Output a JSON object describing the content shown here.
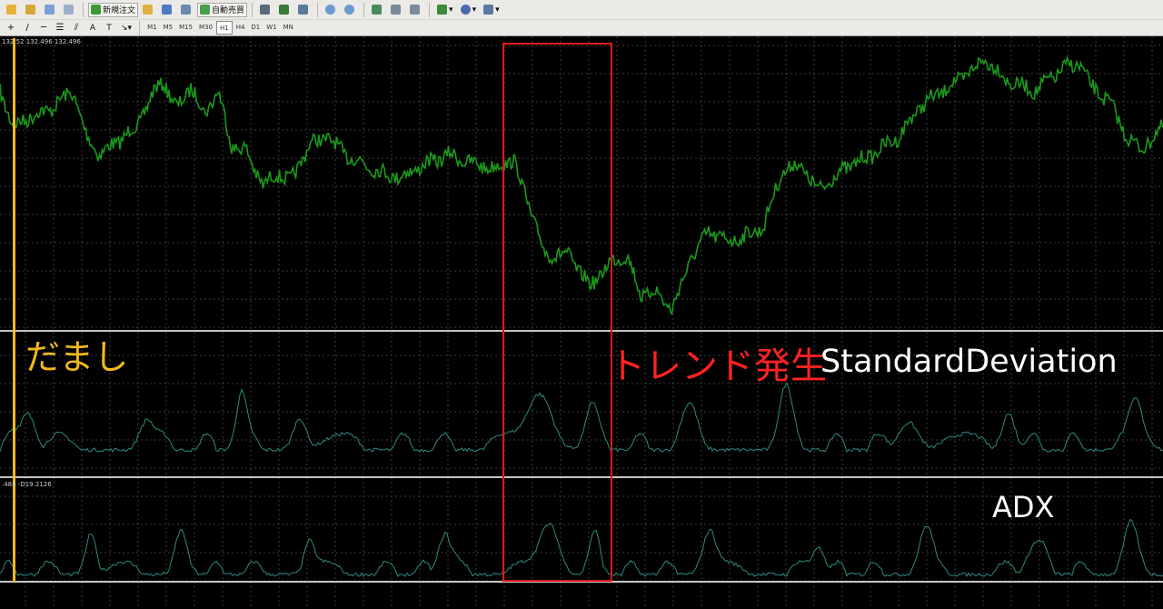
{
  "toolbar": {
    "new_order_label": "新規注文",
    "auto_trade_label": "自動売買"
  },
  "timeframes": [
    "M1",
    "M5",
    "M15",
    "M30",
    "H1",
    "H4",
    "D1",
    "W1",
    "MN"
  ],
  "active_timeframe": "H1",
  "price_readout": "132.52 132.496 132.496",
  "adx_readout": ".484 -D19.2126",
  "annotations": {
    "fake_signal": "だまし",
    "trend_start": "トレンド発生",
    "stddev_name": "StandardDeviation",
    "adx_name": "ADX"
  },
  "colors": {
    "price_line": "#1a9a1a",
    "indicator_line": "#2e8a80",
    "grid": "#3c3c3c",
    "separator": "#c4c4c4",
    "fake_box": "#f2b91c",
    "trend_box": "#e01818",
    "trend_text": "#ff2222",
    "fake_text": "#f2b91c",
    "name_text": "#ffffff"
  }
}
